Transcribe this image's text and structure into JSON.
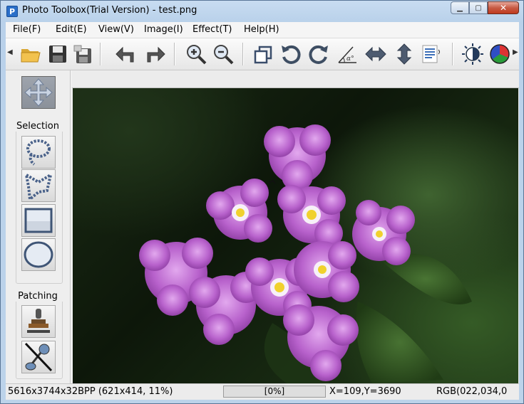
{
  "window": {
    "title": "Photo Toolbox(Trial Version) - test.png",
    "app_icon_letter": "P",
    "minimize_glyph": "▁",
    "maximize_glyph": "▢",
    "close_glyph": "✕"
  },
  "menu": [
    "File(F)",
    "Edit(E)",
    "View(V)",
    "Image(I)",
    "Effect(T)",
    "Help(H)"
  ],
  "toolbar": {
    "scroll_left_glyph": "◀",
    "scroll_right_glyph": "▶",
    "buttons": [
      {
        "icon": "open-folder-icon"
      },
      {
        "icon": "save-icon"
      },
      {
        "icon": "save-as-icon"
      },
      {
        "icon": "undo-icon"
      },
      {
        "icon": "redo-icon"
      },
      {
        "icon": "zoom-in-icon"
      },
      {
        "icon": "zoom-out-icon"
      },
      {
        "icon": "crop-icon"
      },
      {
        "icon": "rotate-left-icon"
      },
      {
        "icon": "rotate-right-icon"
      },
      {
        "icon": "angle-rotate-icon"
      },
      {
        "icon": "flip-horizontal-icon"
      },
      {
        "icon": "flip-vertical-icon"
      },
      {
        "icon": "text-icon"
      },
      {
        "icon": "brightness-icon"
      },
      {
        "icon": "color-balance-icon"
      }
    ],
    "angle_symbol": "α°"
  },
  "side_panel": {
    "selection_label": "Selection",
    "patching_label": "Patching",
    "tools": [
      {
        "icon": "move-icon"
      },
      {
        "icon": "lasso-icon"
      },
      {
        "icon": "polygon-lasso-icon"
      },
      {
        "icon": "rectangle-select-icon"
      },
      {
        "icon": "ellipse-select-icon"
      },
      {
        "icon": "clone-stamp-icon"
      },
      {
        "icon": "remove-tool-icon"
      }
    ]
  },
  "status": {
    "image_info": "5616x3744x32BPP (621x414, 11%)",
    "progress": "[0%]",
    "progress_value": 0,
    "coords": "X=109,Y=3690",
    "color": "RGB(022,034,0"
  },
  "colors": {
    "title_bar": "#c8dcf1",
    "close_button": "#c75b45",
    "canvas_bg": "#0c170a",
    "flower": "#b45fc9",
    "flower_center": "#f4e04a"
  }
}
